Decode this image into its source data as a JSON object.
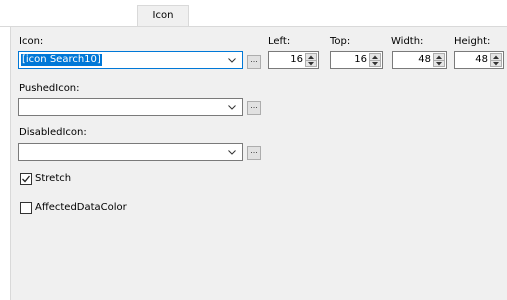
{
  "tabs": [
    {
      "label": "Icon"
    }
  ],
  "fields": {
    "icon": {
      "label": "Icon:",
      "value": "[icon Search10]",
      "ellipsis": "..."
    },
    "pushed_icon": {
      "label": "PushedIcon:",
      "value": "",
      "ellipsis": "..."
    },
    "disabled_icon": {
      "label": "DisabledIcon:",
      "value": "",
      "ellipsis": "..."
    }
  },
  "position": {
    "left": {
      "label": "Left:",
      "value": "16"
    },
    "top": {
      "label": "Top:",
      "value": "16"
    },
    "width": {
      "label": "Width:",
      "value": "48"
    },
    "height": {
      "label": "Height:",
      "value": "48"
    }
  },
  "checkboxes": {
    "stretch": {
      "label": "Stretch",
      "checked": true
    },
    "affected_data_color": {
      "label": "AffectedDataColor",
      "checked": false
    }
  },
  "icons": [
    "chevron-down-icon",
    "spin-up-icon",
    "spin-down-icon",
    "checkmark-icon"
  ],
  "colors": {
    "selection": "#0078d7",
    "panel": "#f0f0f0"
  }
}
